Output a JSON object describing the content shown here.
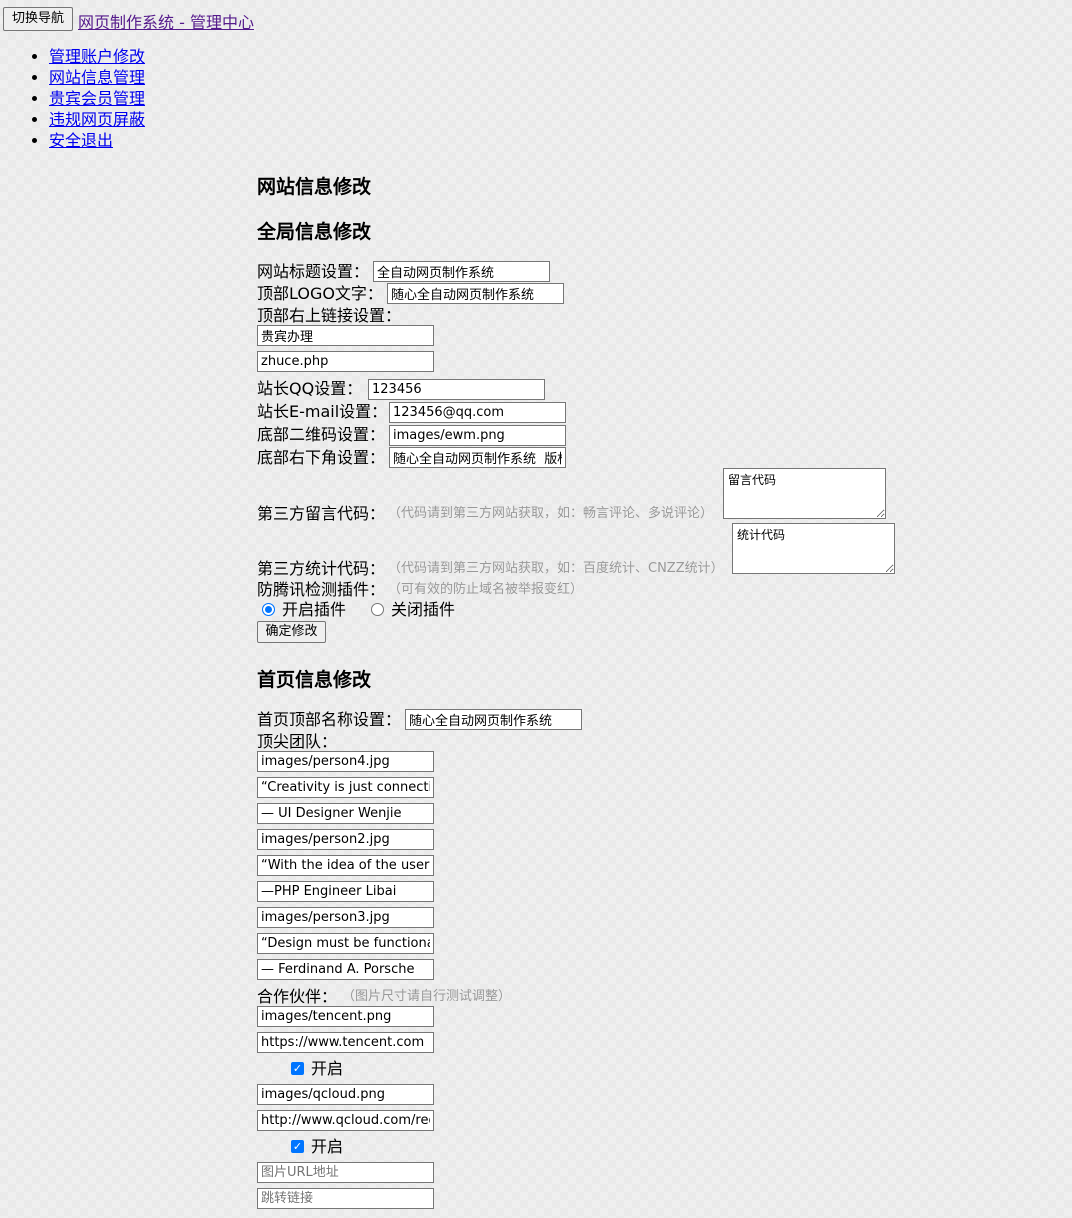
{
  "header": {
    "toggle_nav_label": "切换导航",
    "brand_link": "网页制作系统 - 管理中心"
  },
  "nav": {
    "items": [
      "管理账户修改",
      "网站信息管理",
      "贵宾会员管理",
      "违规网页屏蔽",
      "安全退出"
    ]
  },
  "main": {
    "title": "网站信息修改",
    "global_section": {
      "title": "全局信息修改",
      "site_title_label": "网站标题设置：",
      "site_title_value": "全自动网页制作系统",
      "logo_text_label": "顶部LOGO文字：",
      "logo_text_value": "随心全自动网页制作系统",
      "top_right_link_label": "顶部右上链接设置：",
      "top_right_link_text": "贵宾办理",
      "top_right_link_url": "zhuce.php",
      "qq_label": "站长QQ设置：",
      "qq_value": "123456",
      "email_label": "站长E-mail设置：",
      "email_value": "123456@qq.com",
      "qrcode_label": "底部二维码设置：",
      "qrcode_value": "images/ewm.png",
      "footer_right_label": "底部右下角设置：",
      "footer_right_value": "随心全自动网页制作系统  版权",
      "comment_code_label": "第三方留言代码：",
      "comment_code_hint": "（代码请到第三方网站获取，如：畅言评论、多说评论）",
      "comment_code_value": "留言代码",
      "stats_code_label": "第三方统计代码：",
      "stats_code_hint": "（代码请到第三方网站获取，如：百度统计、CNZZ统计）",
      "stats_code_value": "统计代码",
      "anti_detect_label": "防腾讯检测插件：",
      "anti_detect_hint": "（可有效的防止域名被举报变红）",
      "plugin_on_label": "开启插件",
      "plugin_off_label": "关闭插件",
      "plugin_enabled": true,
      "submit_label": "确定修改"
    },
    "home_section": {
      "title": "首页信息修改",
      "home_name_label": "首页顶部名称设置：",
      "home_name_value": "随心全自动网页制作系统",
      "team_label": "顶尖团队：",
      "team_fields": [
        "images/person4.jpg",
        "“Creativity is just connecting things",
        "— UI Designer Wenjie",
        "images/person2.jpg",
        "“With the idea of the user to start",
        "—PHP Engineer Libai",
        "images/person3.jpg",
        "“Design must be functional and",
        "— Ferdinand A. Porsche"
      ],
      "partners_label": "合作伙伴：",
      "partners_hint": "（图片尺寸请自行测试调整）",
      "partner1_image": "images/tencent.png",
      "partner1_url": "https://www.tencent.com",
      "partner2_image": "images/qcloud.png",
      "partner2_url": "http://www.qcloud.com/redirect",
      "partner_enable_label": "开启",
      "image_url_placeholder": "图片URL地址",
      "jump_link_placeholder": "跳转链接"
    }
  }
}
